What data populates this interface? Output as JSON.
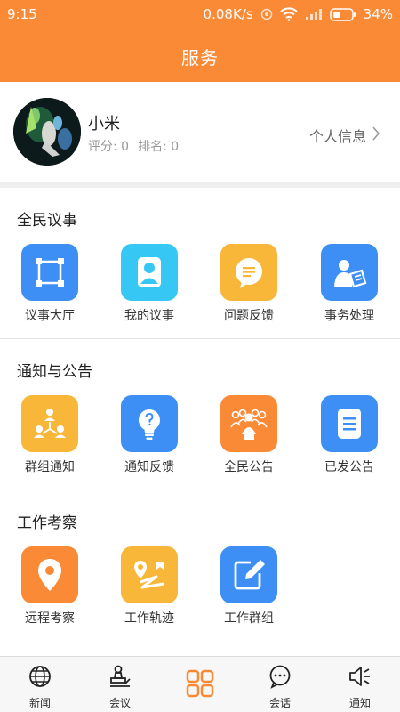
{
  "status_bar": {
    "time": "9:15",
    "network_speed": "0.08K/s",
    "battery": "34%"
  },
  "header": {
    "title": "服务"
  },
  "profile": {
    "name": "小米",
    "score": "评分: 0",
    "rank": "排名: 0",
    "info_link": "个人信息"
  },
  "sections": [
    {
      "title": "全民议事",
      "items": [
        {
          "label": "议事大厅",
          "icon": "frame-icon",
          "color": "#3d8ff5"
        },
        {
          "label": "我的议事",
          "icon": "person-icon",
          "color": "#37c7f4"
        },
        {
          "label": "问题反馈",
          "icon": "message-icon",
          "color": "#f8b739"
        },
        {
          "label": "事务处理",
          "icon": "person-document-icon",
          "color": "#3d8ff5"
        }
      ]
    },
    {
      "title": "通知与公告",
      "items": [
        {
          "label": "群组通知",
          "icon": "group-network-icon",
          "color": "#f8b739"
        },
        {
          "label": "通知反馈",
          "icon": "lightbulb-question-icon",
          "color": "#3d8ff5"
        },
        {
          "label": "全民公告",
          "icon": "crowd-icon",
          "color": "#fb8a37"
        },
        {
          "label": "已发公告",
          "icon": "document-icon",
          "color": "#3d8ff5"
        }
      ]
    },
    {
      "title": "工作考察",
      "items": [
        {
          "label": "远程考察",
          "icon": "location-pin-icon",
          "color": "#fb8a37"
        },
        {
          "label": "工作轨迹",
          "icon": "route-icon",
          "color": "#f8b739"
        },
        {
          "label": "工作群组",
          "icon": "edit-icon",
          "color": "#3d8ff5"
        }
      ]
    }
  ],
  "tabbar": [
    {
      "label": "新闻",
      "icon": "globe-icon"
    },
    {
      "label": "会议",
      "icon": "stamp-icon"
    },
    {
      "label": "",
      "icon": "grid-icon",
      "active": true,
      "color": "#fb8a37"
    },
    {
      "label": "会话",
      "icon": "chat-bubble-icon"
    },
    {
      "label": "通知",
      "icon": "speaker-icon"
    }
  ]
}
